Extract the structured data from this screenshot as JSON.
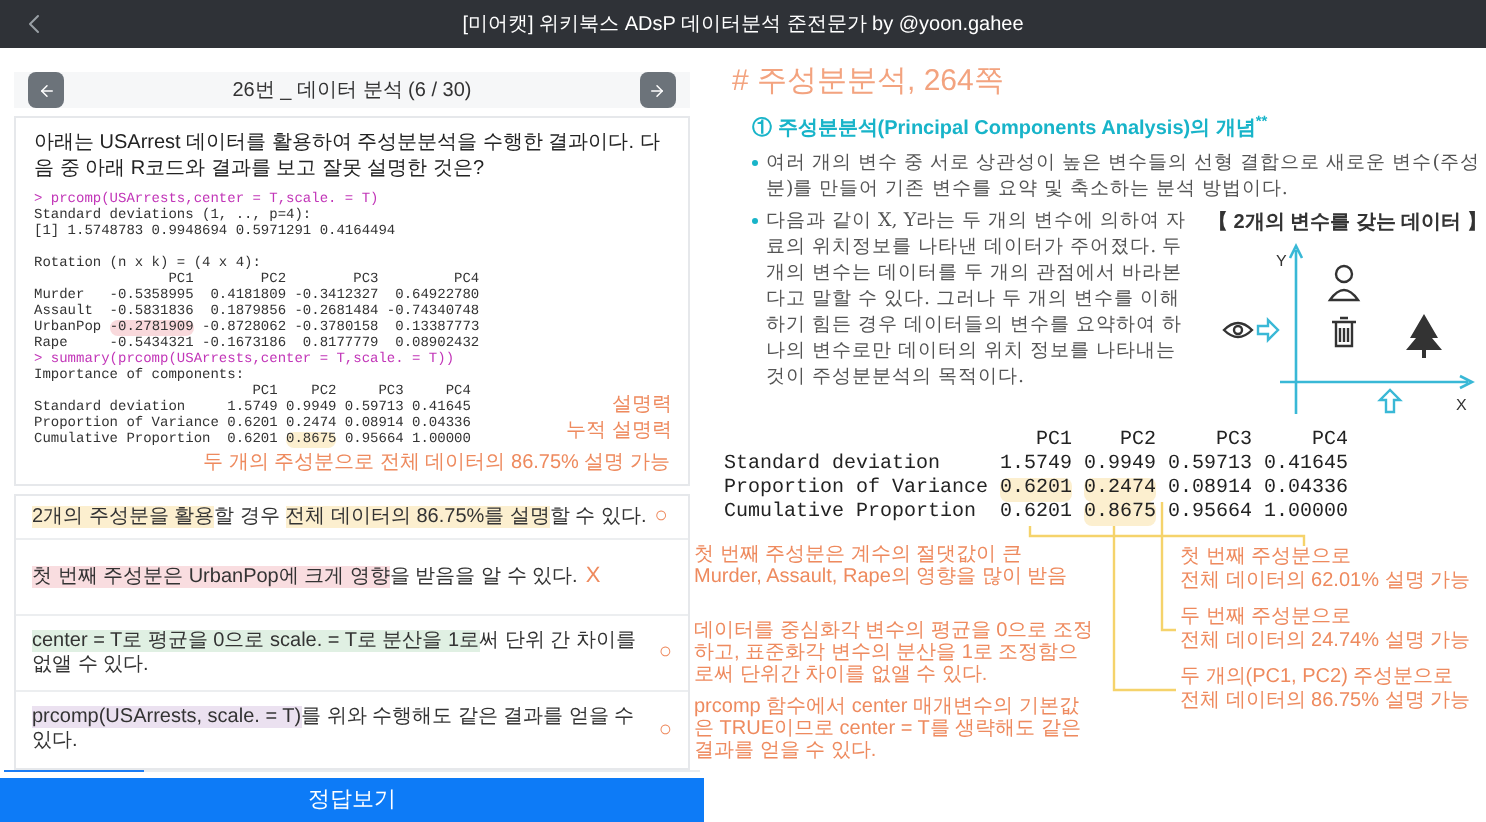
{
  "top_bar": {
    "title": "[미어캣] 위키북스 ADsP 데이터분석 준전문가 by @yoon.gahee"
  },
  "question_nav": {
    "title": "26번 _ 데이터 분석 (6 / 30)"
  },
  "question": {
    "text": "아래는 USArrest 데이터를 활용하여 주성분분석을 수행한 결과이다. 다음 중 아래 R코드와 결과를 보고 잘못 설명한 것은?",
    "code_lines": [
      {
        "kind": "command",
        "text": "> prcomp(USArrests,center = T,scale. = T)"
      },
      {
        "kind": "output",
        "text": "Standard deviations (1, .., p=4):"
      },
      {
        "kind": "output",
        "text": "[1] 1.5748783 0.9948694 0.5971291 0.4164494"
      },
      {
        "kind": "blank"
      },
      {
        "kind": "output",
        "text": "Rotation (n x k) = (4 x 4):"
      },
      {
        "kind": "output",
        "text": "                PC1        PC2        PC3         PC4"
      },
      {
        "kind": "output",
        "text": "Murder   -0.5358995  0.4181809 -0.3412327  0.64922780"
      },
      {
        "kind": "output",
        "text": "Assault  -0.5831836  0.1879856 -0.2681484 -0.74340748"
      },
      {
        "kind": "output",
        "segments": [
          {
            "text": "UrbanPop ",
            "highlighted": false
          },
          {
            "text": "-0.2781909",
            "highlighted": true,
            "color": "#f9d9dc"
          },
          {
            "text": " -0.8728062 -0.3780158  0.13387773",
            "highlighted": false
          }
        ]
      },
      {
        "kind": "output",
        "text": "Rape     -0.5434321 -0.1673186  0.8177779  0.08902432"
      },
      {
        "kind": "command",
        "text": "> summary(prcomp(USArrests,center = T,scale. = T))"
      },
      {
        "kind": "output",
        "text": "Importance of components:"
      },
      {
        "kind": "output",
        "text": "                          PC1    PC2     PC3     PC4"
      },
      {
        "kind": "output",
        "text": "Standard deviation     1.5749 0.9949 0.59713 0.41645"
      },
      {
        "kind": "output",
        "text": "Proportion of Variance 0.6201 0.2474 0.08914 0.04336"
      },
      {
        "kind": "output",
        "segments": [
          {
            "text": "Cumulative Proportion  0.6201 ",
            "highlighted": false
          },
          {
            "text": "0.8675",
            "highlighted": true,
            "color": "#fcefcf"
          },
          {
            "text": " 0.95664 1.00000",
            "highlighted": false
          }
        ]
      }
    ],
    "margin_notes": [
      "설명력",
      "누적 설명력"
    ],
    "table_note": "두 개의 주성분으로 전체 데이터의 86.75% 설명 가능"
  },
  "options": [
    {
      "segments": [
        {
          "text": "2개의 주성분을 활용",
          "highlighted": true
        },
        {
          "text": "할 경우 ",
          "highlighted": false
        },
        {
          "text": "전체 데이터의 86.75%를 설명",
          "highlighted": true
        },
        {
          "text": "할 수 있다.",
          "highlighted": false
        }
      ],
      "color": "#fcefcf",
      "mark": "○"
    },
    {
      "segments": [
        {
          "text": "첫 번째 주성분은 UrbanPop에 크게 영향",
          "highlighted": true
        },
        {
          "text": "을 받음을 알 수 있다.",
          "highlighted": false
        }
      ],
      "color": "#f9dde0",
      "mark": "X",
      "note": "첫 번째 주성분은 계수의 절댓값이 큰 Murder, Assault, Rape의 영향을 많이 받음"
    },
    {
      "segments": [
        {
          "text": "center = T로 평균을 0으로 scale. = T로 분산을 1로",
          "highlighted": true
        },
        {
          "text": "써 단위 간 차이를 없앨 수 있다.",
          "highlighted": false
        }
      ],
      "color": "#e0f0e3",
      "mark": "○",
      "note": "데이터를 중심화각 변수의 평균을 0으로 조정하고, 표준화각 변수의 분산을 1로 조정함으로써 단위간 차이를 없앨 수 있다."
    },
    {
      "segments": [
        {
          "text": "prcomp(USArrests, scale. = T)",
          "highlighted": true
        },
        {
          "text": "를 위와 수행해도 같은 결과를 얻을 수 있다.",
          "highlighted": false
        }
      ],
      "color": "#ebe1f0",
      "mark": "○",
      "note": "prcomp 함수에서 center 매개변수의 기본값은 TRUE이므로 center = T를 생략해도 같은 결과를 얻을 수 있다."
    }
  ],
  "progress": {
    "level": 0.2
  },
  "answer_button": {
    "label": "정답보기"
  },
  "explanation": {
    "heading": "# 주성분분석, 264쪽",
    "subheading": "① 주성분분석(Principal Components Analysis)의 개념$^{**}$",
    "bullets": [
      "여러 개의 변수 중 서로 상관성이 높은 변수들의 선형 결합으로 새로운 변수(주성분)를 만들어 기존 변수를 요약 및 축소하는 분석 방법이다.",
      "다음과 같이 X, Y라는 두 개의 변수에 의하여 자료의 위치정보를 나타낸 데이터가 주어졌다. 두 개의 변수는 데이터를 두 개의 관점에서 바라본다고 말할 수 있다. 그러나 두 개의 변수를 이해하기 힘든 경우 데이터들의 변수를 요약하여 하나의 변수로만 데이터의 위치 정보를 나타내는 것이 주성분분석의 목적이다."
    ],
    "diagram": {
      "caption": "【 2개의 변수를 갖는 데이터 】",
      "y_label": "Y",
      "x_label": "X"
    },
    "summary_table": {
      "columns": [
        "PC1",
        "PC2",
        "PC3",
        "PC4"
      ],
      "rows": [
        {
          "label": "Standard deviation",
          "cells": [
            {
              "text": "1.5749",
              "highlighted": false
            },
            {
              "text": "0.9949",
              "highlighted": false
            },
            {
              "text": "0.59713",
              "highlighted": false
            },
            {
              "text": "0.41645",
              "highlighted": false
            }
          ]
        },
        {
          "label": "Proportion of Variance",
          "cells": [
            {
              "text": "0.6201",
              "highlighted": true
            },
            {
              "text": "0.2474",
              "highlighted": true
            },
            {
              "text": "0.08914",
              "highlighted": false
            },
            {
              "text": "0.04336",
              "highlighted": false
            }
          ]
        },
        {
          "label": "Cumulative Proportion",
          "cells": [
            {
              "text": "0.6201",
              "highlighted": false
            },
            {
              "text": "0.8675",
              "highlighted": true
            },
            {
              "text": "0.95664",
              "highlighted": false
            },
            {
              "text": "1.00000",
              "highlighted": false
            }
          ]
        }
      ]
    },
    "callouts": [
      {
        "lines": [
          "첫 번째 주성분으로",
          "전체 데이터의 62.01% 설명 가능"
        ]
      },
      {
        "lines": [
          "두 번째 주성분으로",
          "전체 데이터의 24.74% 설명 가능"
        ]
      },
      {
        "lines": [
          "두 개의(PC1, PC2) 주성분으로",
          "전체 데이터의 86.75% 설명 가능"
        ]
      }
    ]
  }
}
